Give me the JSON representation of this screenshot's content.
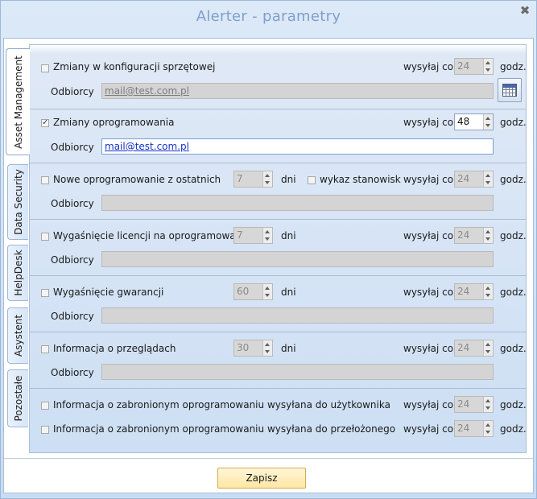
{
  "window": {
    "title": "Alerter - parametry",
    "close_icon": "close-icon"
  },
  "tabs": [
    {
      "label": "Asset Management",
      "active": true
    },
    {
      "label": "Data Security"
    },
    {
      "label": "HelpDesk"
    },
    {
      "label": "Asystent"
    },
    {
      "label": "Pozostałe"
    }
  ],
  "common": {
    "recipients_label": "Odbiorcy",
    "send_every": "wysyłaj co",
    "hours": "godz.",
    "days": "dni"
  },
  "sections": [
    {
      "label": "Zmiany w konfiguracji sprzętowej",
      "checked": false,
      "interval": "24",
      "recipients": "mail@test.com.pl"
    },
    {
      "label": "Zmiany oprogramowania",
      "checked": true,
      "interval": "48",
      "recipients": "mail@test.com.pl"
    },
    {
      "label": "Nowe oprogramowanie z ostatnich",
      "checked": false,
      "days": "7",
      "extra_checkbox": "wykaz stanowisk",
      "interval": "24",
      "recipients": ""
    },
    {
      "label": "Wygaśnięcie licencji na oprogramowanie",
      "checked": false,
      "days": "7",
      "interval": "24",
      "recipients": ""
    },
    {
      "label": "Wygaśnięcie gwarancji",
      "checked": false,
      "days": "60",
      "interval": "24",
      "recipients": ""
    },
    {
      "label": "Informacja o przeglądach",
      "checked": false,
      "days": "30",
      "interval": "24",
      "recipients": ""
    },
    {
      "label": "Informacja o zabronionym oprogramowaniu wysyłana do użytkownika",
      "checked": false,
      "interval": "24"
    },
    {
      "label": "Informacja o zabronionym oprogramowaniu wysyłana do przełożonego",
      "checked": false,
      "interval": "24"
    }
  ],
  "save_label": "Zapisz",
  "colors": {
    "accent": "#7f9fc9",
    "link": "#1432c8",
    "save_bg": "#ffe7a4"
  }
}
